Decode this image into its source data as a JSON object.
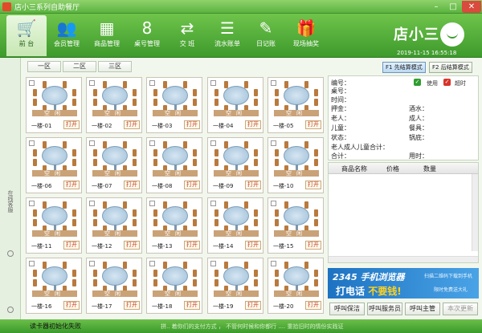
{
  "window": {
    "title": "店小三系列自助餐厅",
    "min": "–",
    "max": "□",
    "close": "✕"
  },
  "nav": [
    {
      "label": "前  台",
      "icon": "cart-icon",
      "glyph": "🛒"
    },
    {
      "label": "会员管理",
      "icon": "members-icon",
      "glyph": "👥"
    },
    {
      "label": "商品管理",
      "icon": "warehouse-icon",
      "glyph": "▦"
    },
    {
      "label": "桌号管理",
      "icon": "table-number-icon",
      "glyph": "8"
    },
    {
      "label": "交  班",
      "icon": "shift-change-icon",
      "glyph": "⇄"
    },
    {
      "label": "流水账单",
      "icon": "ledger-icon",
      "glyph": "☰"
    },
    {
      "label": "日记账",
      "icon": "journal-icon",
      "glyph": "✎"
    },
    {
      "label": "现场抽奖",
      "icon": "gift-icon",
      "glyph": "🎁"
    }
  ],
  "logo": "店小三",
  "datetime": "2019-11-15  16:55:18",
  "sidebar": {
    "vertical_text": "在线客服"
  },
  "zones": [
    "一区",
    "二区",
    "三区"
  ],
  "modes": [
    "F1 先结算模式",
    "F2 后结算模式"
  ],
  "tables": [
    {
      "name": "一楼-01",
      "status": "空闲",
      "open": "打开"
    },
    {
      "name": "一楼-02",
      "status": "空闲",
      "open": "打开"
    },
    {
      "name": "一楼-03",
      "status": "空闲",
      "open": "打开"
    },
    {
      "name": "一楼-04",
      "status": "空闲",
      "open": "打开"
    },
    {
      "name": "一楼-05",
      "status": "空闲",
      "open": "打开"
    },
    {
      "name": "一楼-06",
      "status": "空闲",
      "open": "打开"
    },
    {
      "name": "一楼-07",
      "status": "空闲",
      "open": "打开"
    },
    {
      "name": "一楼-08",
      "status": "空闲",
      "open": "打开"
    },
    {
      "name": "一楼-09",
      "status": "空闲",
      "open": "打开"
    },
    {
      "name": "一楼-10",
      "status": "空闲",
      "open": "打开"
    },
    {
      "name": "一楼-11",
      "status": "空闲",
      "open": "打开"
    },
    {
      "name": "一楼-12",
      "status": "空闲",
      "open": "打开"
    },
    {
      "name": "一楼-13",
      "status": "空闲",
      "open": "打开"
    },
    {
      "name": "一楼-14",
      "status": "空闲",
      "open": "打开"
    },
    {
      "name": "一楼-15",
      "status": "空闲",
      "open": "打开"
    },
    {
      "name": "一楼-16",
      "status": "空闲",
      "open": "打开"
    },
    {
      "name": "一楼-17",
      "status": "空闲",
      "open": "打开"
    },
    {
      "name": "一楼-18",
      "status": "空闲",
      "open": "打开"
    },
    {
      "name": "一楼-19",
      "status": "空闲",
      "open": "打开"
    },
    {
      "name": "一楼-20",
      "status": "空闲",
      "open": "打开"
    }
  ],
  "info": {
    "table_no_label": "编号：",
    "desk_label": "桌号：",
    "time_label": "时间：",
    "deposit_label": "押金：",
    "drinks_label": "酒水：",
    "elder_label": "老人：",
    "adult_label": "成人：",
    "child_label": "儿童：",
    "tableware_label": "餐具：",
    "status_label": "状态：",
    "pot_label": "锅底：",
    "combined_label": "老人成人儿童合计：",
    "total_label": "合计：",
    "duration_label": "用时：",
    "in_use": "使用",
    "overtime": "超时",
    "in_use_color": "#2f9e2f",
    "overtime_color": "#d8352a"
  },
  "order_table": {
    "columns": [
      "商品名称",
      "价格",
      "数量"
    ]
  },
  "ad": {
    "title": "2345 手机浏览器",
    "slogan_a": "打电话",
    "slogan_b": "不要钱!",
    "side1": "扫描二维码下载到手机",
    "side2": "限时免费送大礼"
  },
  "actions": [
    "呼叫保洁",
    "呼叫服务员",
    "呼叫主管",
    "本次更新"
  ],
  "statusbar": {
    "status": "读卡器初始化失败",
    "marquee": "拼..  着你们的支付方式 ， 不管何时候和你都行  .... 重拾旧时的情份实践证"
  }
}
